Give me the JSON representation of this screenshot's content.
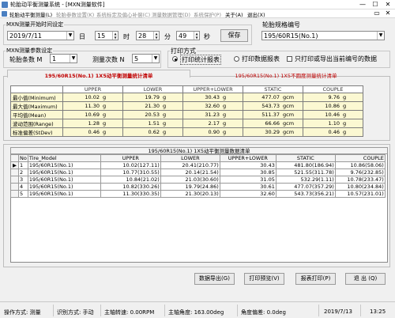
{
  "window": {
    "title": "轮胎动平衡测量系统 - [MXN测量软件]",
    "min": "—",
    "max": "☐",
    "close": "✕"
  },
  "menu": {
    "items": [
      {
        "label": "轮胎动平衡测量(L)",
        "dim": false
      },
      {
        "label": "轮胎参数设置(K)",
        "dim": true
      },
      {
        "label": "系统标定及偏心补偿(C)",
        "dim": true
      },
      {
        "label": "测量数据管理(D)",
        "dim": true
      },
      {
        "label": "系统保护(P)",
        "dim": true
      },
      {
        "label": "关于(A)",
        "dim": false
      },
      {
        "label": "退出(X)",
        "dim": false
      }
    ],
    "restore": "▭",
    "close": "✕"
  },
  "time_group": {
    "label": "MXN测量开始时间设定",
    "date": "2019/7/11",
    "day_label": "日",
    "hour": "15",
    "hour_label": "时",
    "minute": "28",
    "minute_label": "分",
    "second": "49",
    "second_label": "秒",
    "save_button": "保存"
  },
  "spec_group": {
    "label": "轮胎规格编号",
    "value": "195/60R15(No.1)"
  },
  "params_group": {
    "label": "MXN测量参数设定",
    "count_label": "轮胎条数 M",
    "count_value": "1",
    "times_label": "测量次数 N",
    "times_value": "5"
  },
  "print_group": {
    "label": "打印方式",
    "opt1": "打印统计报表",
    "opt2": "打印数据报表",
    "opt3": "只打印或导出当前编号的数据"
  },
  "tabs": {
    "active": "195/60R15(No.1) 1X5动平衡测量统计清单",
    "inactive": "195/60R15(No.1) 1X5不圆度测量统计清单"
  },
  "stats": {
    "headers": [
      "",
      "UPPER",
      "LOWER",
      "UPPER+LOWER",
      "STATIC",
      "COUPLE"
    ],
    "rows": [
      {
        "label": "最小值(Minimum)",
        "cells": [
          [
            "10.02",
            "g"
          ],
          [
            "19.79",
            "g"
          ],
          [
            "30.43",
            "g"
          ],
          [
            "477.07",
            "gcm"
          ],
          [
            "9.76",
            "g"
          ]
        ]
      },
      {
        "label": "最大值(Maximum)",
        "cells": [
          [
            "11.30",
            "g"
          ],
          [
            "21.30",
            "g"
          ],
          [
            "32.60",
            "g"
          ],
          [
            "543.73",
            "gcm"
          ],
          [
            "10.86",
            "g"
          ]
        ]
      },
      {
        "label": "平均值(Mean)",
        "cells": [
          [
            "10.69",
            "g"
          ],
          [
            "20.53",
            "g"
          ],
          [
            "31.23",
            "g"
          ],
          [
            "511.37",
            "gcm"
          ],
          [
            "10.46",
            "g"
          ]
        ]
      },
      {
        "label": "波动范围(Range)",
        "cells": [
          [
            "1.28",
            "g"
          ],
          [
            "1.51",
            "g"
          ],
          [
            "2.17",
            "g"
          ],
          [
            "66.66",
            "gcm"
          ],
          [
            "1.10",
            "g"
          ]
        ]
      },
      {
        "label": "标准偏差(StDev)",
        "cells": [
          [
            "0.46",
            "g"
          ],
          [
            "0.62",
            "g"
          ],
          [
            "0.90",
            "g"
          ],
          [
            "30.29",
            "gcm"
          ],
          [
            "0.46",
            "g"
          ]
        ]
      }
    ]
  },
  "grid": {
    "caption": "195/60R15(No.1) 1X5动平衡测量数据清单",
    "headers": [
      "No",
      "Tire_Model",
      "UPPER",
      "LOWER",
      "UPPER+LOWER",
      "STATIC",
      "COUPLE"
    ],
    "rows": [
      {
        "marker": "▶",
        "no": "1",
        "model": "195/60R15(No.1)",
        "upper": "10.02(127.11)",
        "lower": "20.41(210.77)",
        "ul": "30.43",
        "static": "481.80(186.94)",
        "couple": "10.86(58.06)"
      },
      {
        "marker": "",
        "no": "2",
        "model": "195/60R15(No.1)",
        "upper": "10.77(310.55)",
        "lower": "20.14(21.54)",
        "ul": "30.85",
        "static": "521.55(311.78)",
        "couple": "9.76(232.85)"
      },
      {
        "marker": "",
        "no": "3",
        "model": "195/60R15(No.1)",
        "upper": "10.84(21.02)",
        "lower": "21.03(30.60)",
        "ul": "31.05",
        "static": "532.29(1.11)",
        "couple": "10.78(233.47)"
      },
      {
        "marker": "",
        "no": "4",
        "model": "195/60R15(No.1)",
        "upper": "10.82(330.26)",
        "lower": "19.79(24.86)",
        "ul": "30.61",
        "static": "477.07(357.29)",
        "couple": "10.80(234.84)"
      },
      {
        "marker": "",
        "no": "5",
        "model": "195/60R15(No.1)",
        "upper": "11.30(330.35)",
        "lower": "21.30(20.13)",
        "ul": "32.60",
        "static": "543.73(356.21)",
        "couple": "10.57(231.01)"
      }
    ]
  },
  "buttons": {
    "export": "数据导出(G)",
    "preview": "打印预览(V)",
    "print": "报表打印(P)",
    "exit": "退 出 (Q)"
  },
  "status": {
    "op_mode": "操作方式: 测量",
    "id_mode": "识别方式: 手动",
    "spindle_speed": "主轴转速: 0.00RPM",
    "spindle_angle": "主轴角度: 163.00deg",
    "angle_dev": "角度偏差: 0.0deg",
    "date": "2019/7/13",
    "time": "13:25"
  }
}
